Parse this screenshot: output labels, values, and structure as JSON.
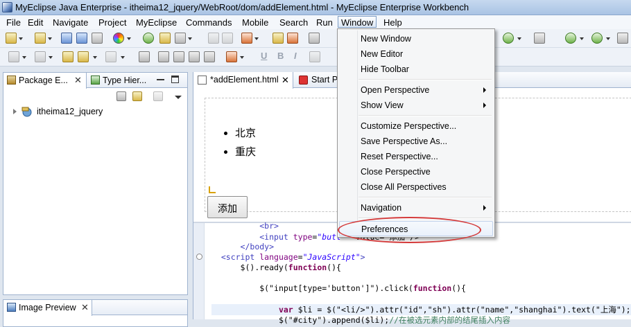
{
  "window": {
    "title": "MyEclipse Java Enterprise - itheima12_jquery/WebRoot/dom/addElement.html - MyEclipse Enterprise Workbench"
  },
  "menubar": {
    "items": [
      "File",
      "Edit",
      "Navigate",
      "Project",
      "MyEclipse",
      "Commands",
      "Mobile",
      "Search",
      "Run",
      "Window",
      "Help"
    ],
    "active": "Window"
  },
  "toolbar2": {
    "underline": "U",
    "bold": "B",
    "italic": "I"
  },
  "left_panel": {
    "tabs": [
      {
        "label": "Package E...",
        "icon": "package-explorer-icon"
      },
      {
        "label": "Type Hier...",
        "icon": "type-hierarchy-icon"
      }
    ],
    "tree": [
      {
        "label": "itheima12_jquery",
        "icon": "web-project-icon"
      }
    ]
  },
  "bottom_panel": {
    "tab_label": "Image Preview"
  },
  "editor": {
    "tabs": [
      {
        "label": "*addElement.html",
        "icon": "html-file-icon"
      },
      {
        "label": "Start Pa",
        "icon": "start-page-icon"
      }
    ],
    "design": {
      "list_items": [
        "北京",
        "重庆"
      ],
      "button_label": "添加"
    },
    "code_lines": [
      {
        "indent": "          ",
        "parts": [
          [
            "tag",
            "<br>"
          ]
        ]
      },
      {
        "indent": "          ",
        "parts": [
          [
            "tag",
            "<input "
          ],
          [
            "attr",
            "type"
          ],
          [
            "plain",
            "="
          ],
          [
            "str",
            "\"butt"
          ],
          [
            "plain",
            "   value=\"添加\"/>"
          ]
        ]
      },
      {
        "indent": "      ",
        "parts": [
          [
            "tag",
            "</body>"
          ]
        ]
      },
      {
        "indent": "  ",
        "parts": [
          [
            "tag",
            "<script "
          ],
          [
            "attr",
            "language"
          ],
          [
            "plain",
            "="
          ],
          [
            "str",
            "\"JavaScript\""
          ],
          [
            "tag",
            ">"
          ]
        ]
      },
      {
        "indent": "      ",
        "parts": [
          [
            "plain",
            "$().ready("
          ],
          [
            "kw",
            "function"
          ],
          [
            "plain",
            "(){"
          ]
        ]
      },
      {
        "indent": "",
        "parts": [
          [
            "plain",
            ""
          ]
        ]
      },
      {
        "indent": "          ",
        "parts": [
          [
            "plain",
            "$(\"input[type='button']\").click("
          ],
          [
            "kw",
            "function"
          ],
          [
            "plain",
            "(){"
          ]
        ]
      },
      {
        "indent": "",
        "parts": [
          [
            "plain",
            ""
          ]
        ]
      },
      {
        "indent": "              ",
        "parts": [
          [
            "kw",
            "var"
          ],
          [
            "plain",
            " $li = $(\"<li/>\").attr(\"id\",\"sh\").attr(\"name\",\"shanghai\").text(\"上海\");"
          ]
        ]
      },
      {
        "indent": "              ",
        "parts": [
          [
            "plain",
            "$(\"#city\").append($li);"
          ],
          [
            "cmt",
            "//在被选元素内部的结尾插入内容"
          ]
        ]
      }
    ]
  },
  "window_menu": {
    "groups": [
      [
        {
          "label": "New Window"
        },
        {
          "label": "New Editor"
        },
        {
          "label": "Hide Toolbar"
        }
      ],
      [
        {
          "label": "Open Perspective",
          "submenu": true
        },
        {
          "label": "Show View",
          "submenu": true
        }
      ],
      [
        {
          "label": "Customize Perspective..."
        },
        {
          "label": "Save Perspective As..."
        },
        {
          "label": "Reset Perspective..."
        },
        {
          "label": "Close Perspective"
        },
        {
          "label": "Close All Perspectives"
        }
      ],
      [
        {
          "label": "Navigation",
          "submenu": true
        }
      ],
      [
        {
          "label": "Preferences",
          "highlighted": true
        }
      ]
    ],
    "highlight_color": "#d43a3a"
  }
}
